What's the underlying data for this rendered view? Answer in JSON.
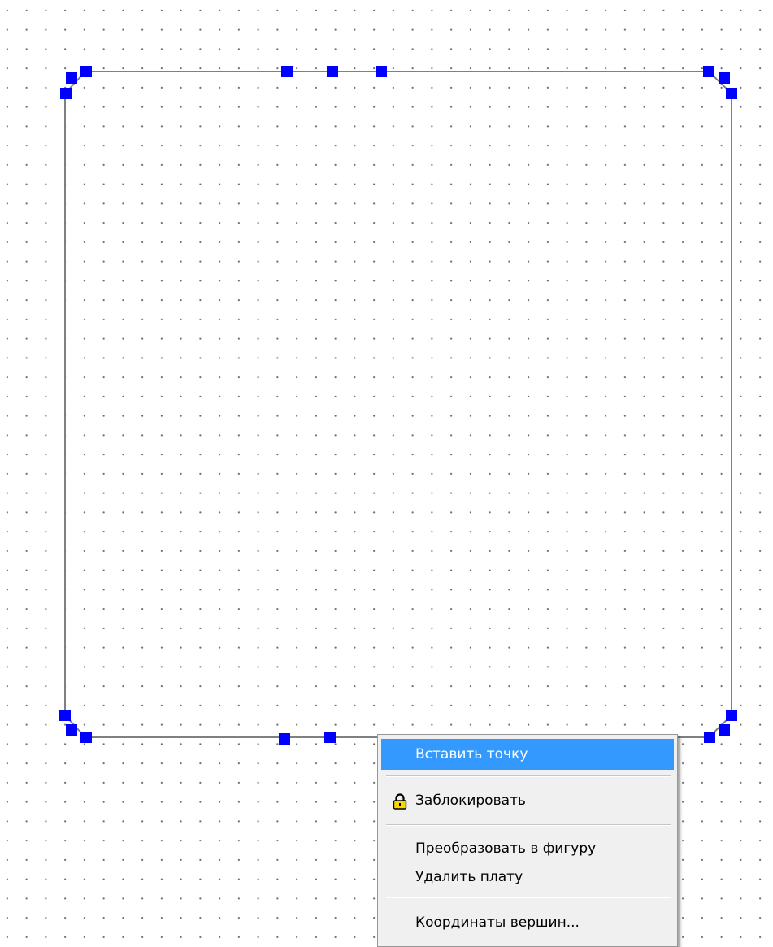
{
  "colors": {
    "background": "#ffffff",
    "grid_dot": "#6a6a6a",
    "board_outline": "#808080",
    "vertex_handle": "#0000ff",
    "menu_background": "#f0f0f0",
    "menu_highlight": "#3399ff",
    "lock_icon": "#f5d800"
  },
  "context_menu": {
    "items": [
      {
        "label": "Вставить точку",
        "highlighted": true
      },
      {
        "label": "Заблокировать",
        "icon": "lock-icon"
      },
      {
        "label": "Преобразовать в фигуру"
      },
      {
        "label": "Удалить плату"
      },
      {
        "label": "Координаты вершин..."
      }
    ]
  }
}
